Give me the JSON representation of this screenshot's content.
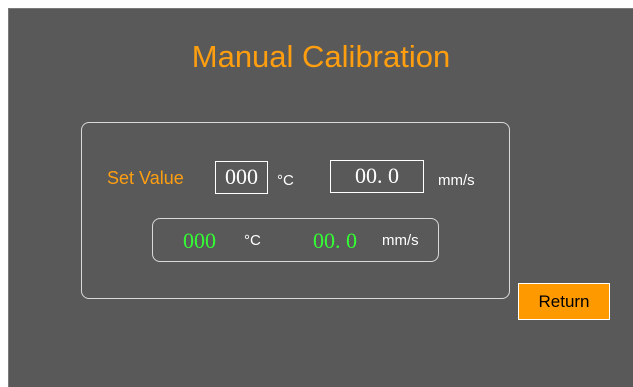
{
  "title": "Manual Calibration",
  "set_value": {
    "label": "Set Value",
    "temperature": "000",
    "temperature_unit": "°C",
    "speed": "00. 0",
    "speed_unit": "mm/s"
  },
  "current_value": {
    "temperature": "000",
    "temperature_unit": "°C",
    "speed": "00. 0",
    "speed_unit": "mm/s"
  },
  "buttons": {
    "return_label": "Return"
  },
  "colors": {
    "background": "#595959",
    "accent_orange": "#ff9f10",
    "button_orange": "#ff9900",
    "readout_green": "#33ff33"
  }
}
